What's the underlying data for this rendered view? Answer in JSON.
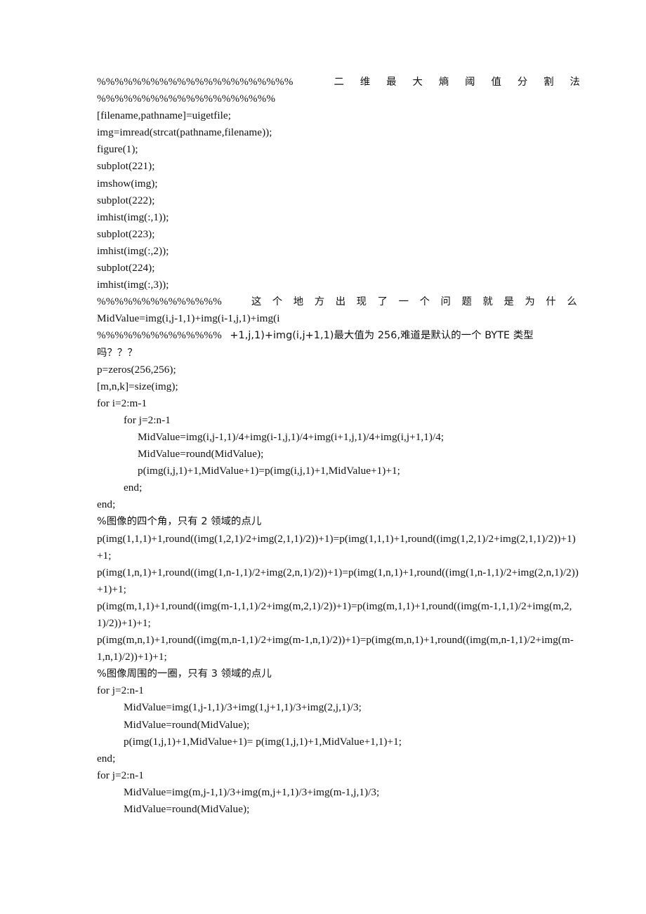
{
  "document": {
    "type": "matlab-source-listing",
    "title_comment": {
      "percent_prefix": "%%%%%%%%%%%%%%%%%%%%%%",
      "title_chars": [
        "二",
        "维",
        "最",
        "大",
        "熵",
        "阈",
        "值",
        "分",
        "割",
        "法"
      ],
      "title_text": "二维最大熵阈值分割法"
    },
    "lines": [
      {
        "id": "l2",
        "text": "%%%%%%%%%%%%%%%%%%%%",
        "indent": 0
      },
      {
        "id": "l3",
        "text": "[filename,pathname]=uigetfile;",
        "indent": 0
      },
      {
        "id": "l4",
        "text": "img=imread(strcat(pathname,filename));",
        "indent": 0
      },
      {
        "id": "l5",
        "text": "figure(1);",
        "indent": 0
      },
      {
        "id": "l6",
        "text": "subplot(221);",
        "indent": 0
      },
      {
        "id": "l7",
        "text": "imshow(img);",
        "indent": 0
      },
      {
        "id": "l8",
        "text": "subplot(222);",
        "indent": 0
      },
      {
        "id": "l9",
        "text": "imhist(img(:,1));",
        "indent": 0
      },
      {
        "id": "l10",
        "text": "subplot(223);",
        "indent": 0
      },
      {
        "id": "l11",
        "text": "imhist(img(:,2));",
        "indent": 0
      },
      {
        "id": "l12",
        "text": "subplot(224);",
        "indent": 0
      },
      {
        "id": "l13",
        "text": "imhist(img(:,3));",
        "indent": 0
      }
    ],
    "comment_block_1": {
      "percent_prefix": "%%%%%%%%%%%%%%",
      "phrase_chars": [
        "这",
        "个",
        "地",
        "方",
        "出",
        "现",
        "了",
        "一",
        "个",
        "问",
        "题",
        "就",
        "是",
        "为",
        "什",
        "么"
      ],
      "phrase_text": "这个地方出现了一个问题就是为什么"
    },
    "line_midvalue_split": "MidValue=img(i,j-1,1)+img(i-1,j,1)+img(i",
    "comment_block_2": {
      "percent_prefix": "%%%%%%%%%%%%%%",
      "rest": "+1,j,1)+img(i,j+1,1)最大值为 256,难道是默认的一个 BYTE 类型",
      "continuation": "吗？？？"
    },
    "lines2": [
      {
        "id": "m1",
        "text": "p=zeros(256,256);",
        "indent": 0
      },
      {
        "id": "m2",
        "text": "[m,n,k]=size(img);",
        "indent": 0
      },
      {
        "id": "m3",
        "text": "for i=2:m-1",
        "indent": 0
      },
      {
        "id": "m4",
        "text": "for j=2:n-1",
        "indent": 1
      },
      {
        "id": "m5",
        "text": "MidValue=img(i,j-1,1)/4+img(i-1,j,1)/4+img(i+1,j,1)/4+img(i,j+1,1)/4;",
        "indent": 2
      },
      {
        "id": "m6",
        "text": "MidValue=round(MidValue);",
        "indent": 2
      },
      {
        "id": "m7",
        "text": "p(img(i,j,1)+1,MidValue+1)=p(img(i,j,1)+1,MidValue+1)+1;",
        "indent": 2
      },
      {
        "id": "m8",
        "text": "end;",
        "indent": 1
      },
      {
        "id": "m9",
        "text": "end;",
        "indent": 0
      }
    ],
    "comment_corners": "%图像的四个角，只有 2 领域的点儿",
    "corner_lines": [
      {
        "id": "c1",
        "text": "p(img(1,1,1)+1,round((img(1,2,1)/2+img(2,1,1)/2))+1)=p(img(1,1,1)+1,round((img(1,2,1)/2+img(2,1,1)/2))+1)+1;"
      },
      {
        "id": "c2",
        "text": "p(img(1,n,1)+1,round((img(1,n-1,1)/2+img(2,n,1)/2))+1)=p(img(1,n,1)+1,round((img(1,n-1,1)/2+img(2,n,1)/2))+1)+1;"
      },
      {
        "id": "c3",
        "text": "p(img(m,1,1)+1,round((img(m-1,1,1)/2+img(m,2,1)/2))+1)=p(img(m,1,1)+1,round((img(m-1,1,1)/2+img(m,2,1)/2))+1)+1;"
      },
      {
        "id": "c4",
        "text": "p(img(m,n,1)+1,round((img(m,n-1,1)/2+img(m-1,n,1)/2))+1)=p(img(m,n,1)+1,round((img(m,n-1,1)/2+img(m-1,n,1)/2))+1)+1;"
      }
    ],
    "comment_border": "%图像周围的一圈，只有 3 领域的点儿",
    "border_lines_top": [
      {
        "id": "b1",
        "text": "for j=2:n-1",
        "indent": 0
      },
      {
        "id": "b2",
        "text": "MidValue=img(1,j-1,1)/3+img(1,j+1,1)/3+img(2,j,1)/3;",
        "indent": 1
      },
      {
        "id": "b3",
        "text": "MidValue=round(MidValue);",
        "indent": 1
      },
      {
        "id": "b4",
        "text": "p(img(1,j,1)+1,MidValue+1)= p(img(1,j,1)+1,MidValue+1,1)+1;",
        "indent": 1
      },
      {
        "id": "b5",
        "text": "end;",
        "indent": 0
      }
    ],
    "border_lines_bottom": [
      {
        "id": "b6",
        "text": "for j=2:n-1",
        "indent": 0
      },
      {
        "id": "b7",
        "text": "MidValue=img(m,j-1,1)/3+img(m,j+1,1)/3+img(m-1,j,1)/3;",
        "indent": 1
      },
      {
        "id": "b8",
        "text": "MidValue=round(MidValue);",
        "indent": 1
      }
    ]
  }
}
